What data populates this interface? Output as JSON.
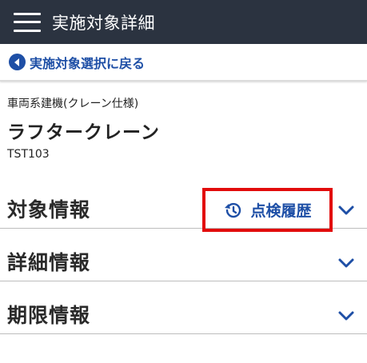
{
  "app_bar": {
    "title": "実施対象詳細"
  },
  "back": {
    "label": "実施対象選択に戻る"
  },
  "target": {
    "category": "車両系建機(クレーン仕様)",
    "name": "ラフタークレーン",
    "code": "TST103"
  },
  "sections": [
    {
      "title": "対象情報"
    },
    {
      "title": "詳細情報"
    },
    {
      "title": "期限情報"
    }
  ],
  "history_button": {
    "label": "点検履歴"
  },
  "colors": {
    "app_bar": "#2b3340",
    "accent": "#1e4fa6",
    "highlight": "#e20b0b"
  },
  "icons": [
    "menu-icon",
    "back-arrow-icon",
    "history-icon",
    "chevron-down-icon"
  ]
}
